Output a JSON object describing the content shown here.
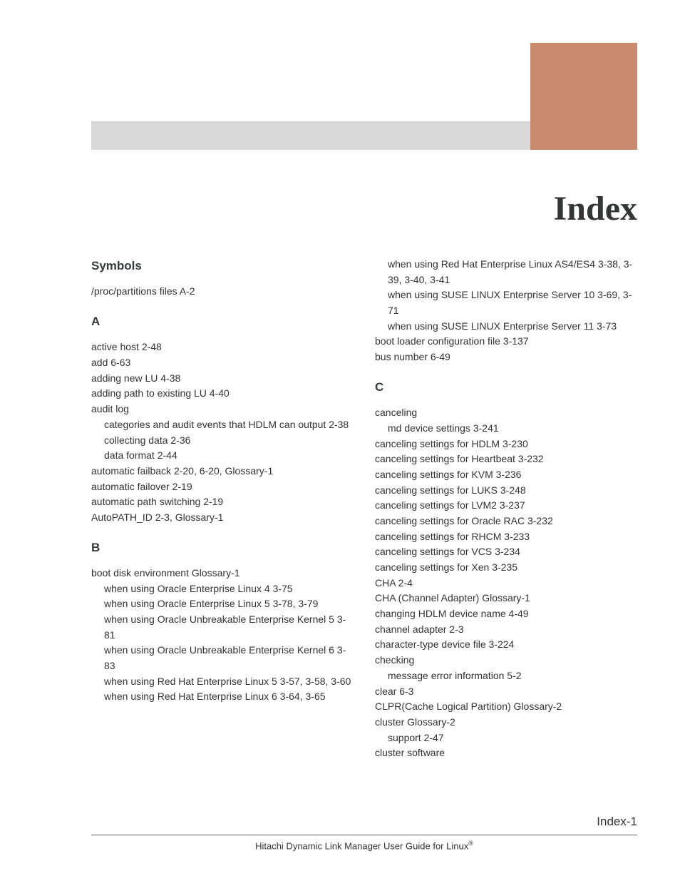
{
  "title": "Index",
  "page_number": "Index-1",
  "footer_title": "Hitachi Dynamic Link Manager User Guide for Linux",
  "footer_reg": "®",
  "left": {
    "h_symbols": "Symbols",
    "symbols_1": "/proc/partitions files    A-2",
    "h_a": "A",
    "a1": "active host    2-48",
    "a2": "add    6-63",
    "a3": "adding new LU    4-38",
    "a4": "adding path to existing LU    4-40",
    "a5": "audit log",
    "a5s1": "categories and audit events that HDLM can output    2-38",
    "a5s2": "collecting data    2-36",
    "a5s3": "data format    2-44",
    "a6": "automatic failback    2-20, 6-20, Glossary-1",
    "a7": "automatic failover    2-19",
    "a8": "automatic path switching    2-19",
    "a9": "AutoPATH_ID    2-3, Glossary-1",
    "h_b": "B",
    "b1": "boot disk environment    Glossary-1",
    "b1s1": "when using Oracle Enterprise Linux 4    3-75",
    "b1s2": "when using Oracle Enterprise Linux 5 3-78, 3-79",
    "b1s3": "when using Oracle Unbreakable Enterprise Kernel 5    3-81",
    "b1s4": "when using Oracle Unbreakable Enterprise Kernel 6    3-83",
    "b1s5": "when using Red Hat Enterprise Linux 5    3-57, 3-58, 3-60",
    "b1s6": "when using Red Hat Enterprise Linux 6    3-64, 3-65"
  },
  "right": {
    "r1": "when using Red Hat Enterprise Linux AS4/ES4 3-38, 3-39, 3-40, 3-41",
    "r2": "when using SUSE LINUX Enterprise Server 10 3-69, 3-71",
    "r3": "when using SUSE LINUX Enterprise Server 11 3-73",
    "r4": "boot loader configuration file    3-137",
    "r5": "bus number    6-49",
    "h_c": "C",
    "c1": "canceling",
    "c1s1": "md device settings    3-241",
    "c2": "canceling settings for HDLM    3-230",
    "c3": "canceling settings for Heartbeat    3-232",
    "c4": "canceling settings for KVM    3-236",
    "c5": "canceling settings for LUKS    3-248",
    "c6": "canceling settings for LVM2    3-237",
    "c7": "canceling settings for Oracle RAC    3-232",
    "c8": "canceling settings for RHCM    3-233",
    "c9": "canceling settings for VCS    3-234",
    "c10": "canceling settings for Xen    3-235",
    "c11": "CHA    2-4",
    "c12": "CHA (Channel Adapter)    Glossary-1",
    "c13": "changing HDLM device name    4-49",
    "c14": "channel adapter    2-3",
    "c15": "character-type device file    3-224",
    "c16": "checking",
    "c16s1": "message error information    5-2",
    "c17": "clear    6-3",
    "c18": "CLPR(Cache Logical Partition)    Glossary-2",
    "c19": "cluster    Glossary-2",
    "c19s1": "support    2-47",
    "c20": "cluster software"
  }
}
